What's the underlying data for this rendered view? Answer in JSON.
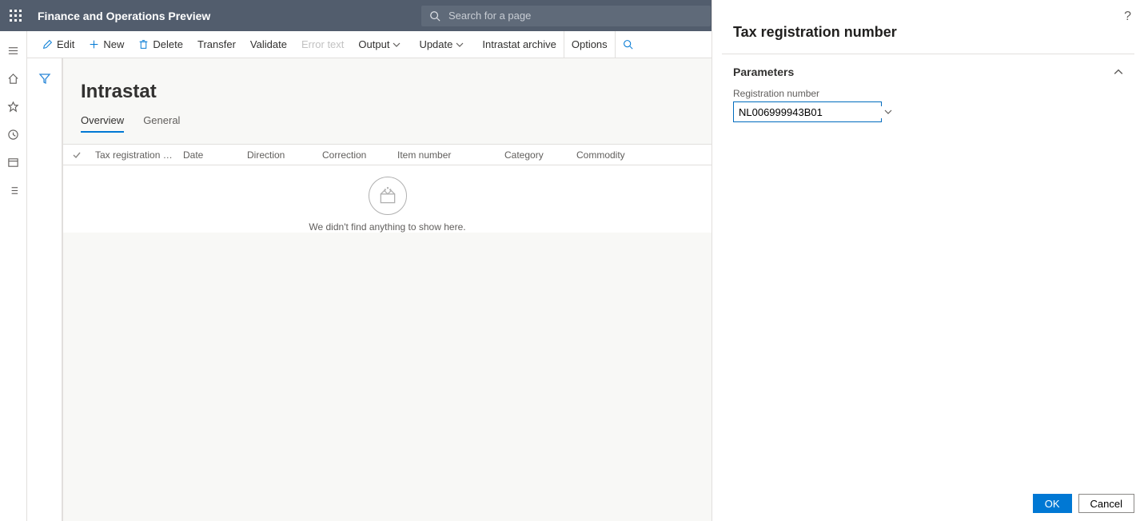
{
  "app": {
    "title": "Finance and Operations Preview"
  },
  "search": {
    "placeholder": "Search for a page"
  },
  "actions": {
    "edit": "Edit",
    "new": "New",
    "delete": "Delete",
    "transfer": "Transfer",
    "validate": "Validate",
    "error_text": "Error text",
    "output": "Output",
    "update": "Update",
    "intrastat_archive": "Intrastat archive",
    "options": "Options"
  },
  "page": {
    "title": "Intrastat"
  },
  "tabs": {
    "overview": "Overview",
    "general": "General"
  },
  "grid": {
    "columns": [
      "Tax registration num...",
      "Date",
      "Direction",
      "Correction",
      "Item number",
      "Category",
      "Commodity"
    ],
    "empty_text": "We didn't find anything to show here."
  },
  "panel": {
    "title": "Tax registration number",
    "section": "Parameters",
    "registration_label": "Registration number",
    "registration_value": "NL006999943B01",
    "ok": "OK",
    "cancel": "Cancel",
    "help": "?"
  }
}
